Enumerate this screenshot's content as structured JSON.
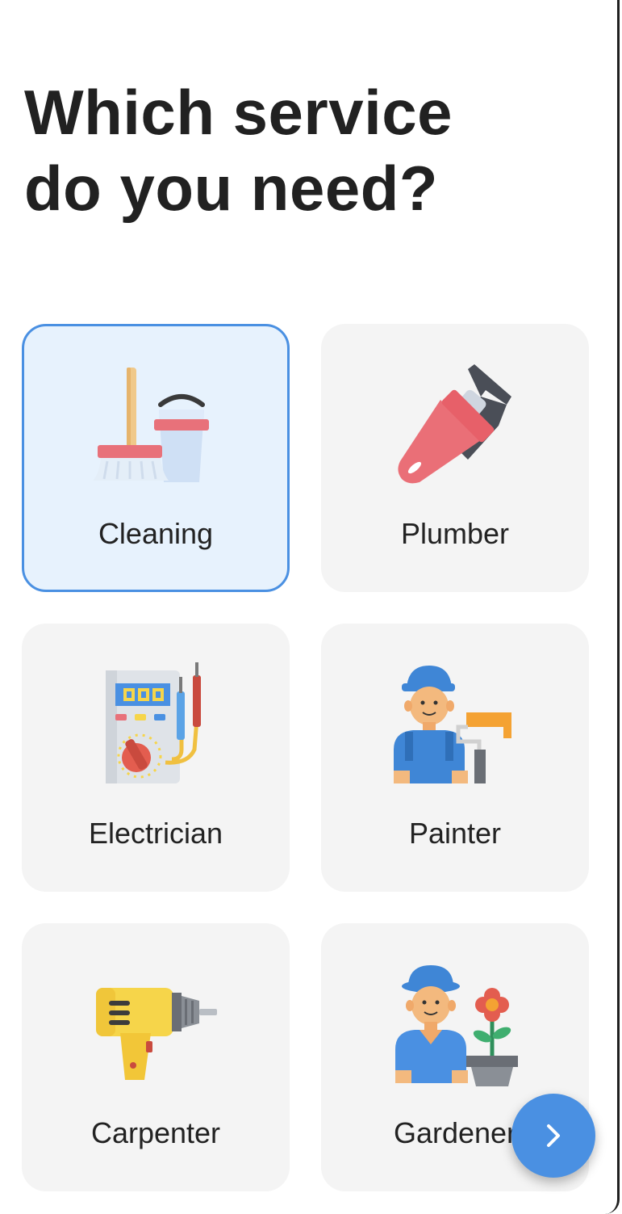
{
  "heading": {
    "line1": "Which service",
    "line2": "do you need?"
  },
  "services": [
    {
      "label": "Cleaning",
      "icon": "cleaning-icon",
      "selected": true
    },
    {
      "label": "Plumber",
      "icon": "wrench-icon",
      "selected": false
    },
    {
      "label": "Electrician",
      "icon": "multimeter-icon",
      "selected": false
    },
    {
      "label": "Painter",
      "icon": "painter-icon",
      "selected": false
    },
    {
      "label": "Carpenter",
      "icon": "drill-icon",
      "selected": false
    },
    {
      "label": "Gardener",
      "icon": "gardener-icon",
      "selected": false
    }
  ],
  "next_button": {
    "icon": "chevron-right-icon"
  },
  "colors": {
    "accent": "#4a90e2",
    "selected_bg": "#e7f2fd",
    "card_bg": "#f4f4f4",
    "text": "#212121"
  }
}
